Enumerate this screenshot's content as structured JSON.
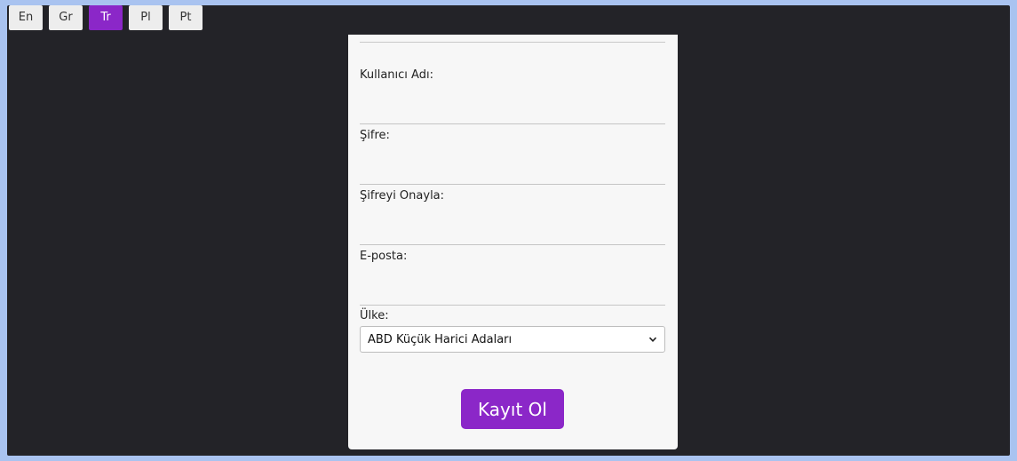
{
  "languages": {
    "items": [
      "En",
      "Gr",
      "Tr",
      "Pl",
      "Pt"
    ],
    "active": "Tr"
  },
  "form": {
    "username_label": "Kullanıcı Adı:",
    "password_label": "Şifre:",
    "confirm_label": "Şifreyi Onayla:",
    "email_label": "E-posta:",
    "country_label": "Ülke:",
    "country_value": "ABD Küçük Harici Adaları",
    "submit_label": "Kayıt Ol"
  },
  "colors": {
    "accent": "#8b27c8",
    "background": "#232328",
    "card": "#f7f7f7"
  }
}
